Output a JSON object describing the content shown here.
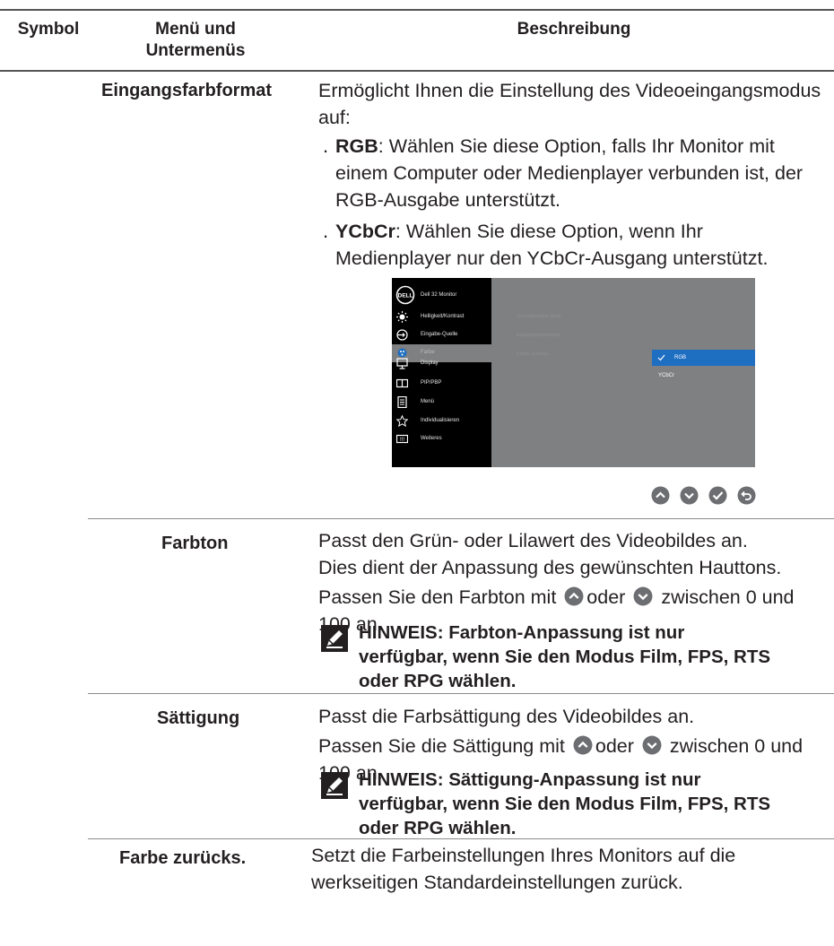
{
  "header": {
    "symbol": "Symbol",
    "menu_line1": "Menü und",
    "menu_line2": "Untermenüs",
    "description": "Beschreibung"
  },
  "rows": {
    "eingangsfarbformat": {
      "label": "Eingangsfarbformat",
      "desc_line1": "Ermöglicht Ihnen die Einstellung des Videoeingangsmodus",
      "desc_line2": "auf:",
      "rgb": {
        "term": "RGB",
        "line1": ": Wählen Sie diese Option, falls Ihr Monitor mit",
        "line2": "einem Computer oder Medienplayer verbunden ist, der",
        "line3": "RGB-Ausgabe unterstützt."
      },
      "ycbcr": {
        "term": "YCbCr",
        "line1": ": Wählen Sie diese Option, wenn Ihr",
        "line2": "Medienplayer nur den YCbCr-Ausgang unterstützt."
      }
    },
    "farbton": {
      "label": "Farbton",
      "line1": "Passt den Grün- oder Lilawert des Videobildes an.",
      "line2": "Dies dient der Anpassung des gewünschten Hauttons.",
      "line3a": "Passen Sie den Farbton mit",
      "line3b": "oder",
      "line3c": "zwischen 0 und",
      "line4": "100 an.",
      "note1": "HINWEIS: Farbton-Anpassung ist nur",
      "note2": "verfügbar, wenn Sie den Modus Film, FPS, RTS",
      "note3": "oder RPG wählen."
    },
    "saettigung": {
      "label": "Sättigung",
      "line1": "Passt die Farbsättigung des Videobildes an.",
      "line2a": "Passen Sie die Sättigung mit",
      "line2b": "oder",
      "line2c": "zwischen 0 und",
      "line3": "100 an.",
      "note1": "HINWEIS: Sättigung-Anpassung ist nur",
      "note2": "verfügbar, wenn Sie den Modus Film, FPS, RTS",
      "note3": "oder RPG wählen."
    },
    "farbe_zuruecks": {
      "label": "Farbe zurücks.",
      "line1": "Setzt die Farbeinstellungen Ihres Monitors auf die",
      "line2": "werkseitigen Standardeinstellungen zurück."
    }
  },
  "osd": {
    "logo": "DELL",
    "title": "Dell 32 Monitor",
    "menu": [
      {
        "label": "Helligkeit/Kontrast",
        "icon": "brightness-icon"
      },
      {
        "label": "Eingabe-Quelle",
        "icon": "input-source-icon"
      },
      {
        "label": "Farbe",
        "icon": "color-icon"
      },
      {
        "label": "Display",
        "icon": "display-icon"
      },
      {
        "label": "PIP/PBP",
        "icon": "pip-pbp-icon"
      },
      {
        "label": "Menü",
        "icon": "menu-icon"
      },
      {
        "label": "Individualisieren",
        "icon": "star-icon"
      },
      {
        "label": "Weiteres",
        "icon": "others-icon"
      }
    ],
    "submenu": [
      "Voreingestellte Modi",
      "Eingangsfarbformat",
      "Farbe zurücks."
    ],
    "options": [
      "RGB",
      "YCbCr"
    ],
    "nav_buttons": [
      "up-button-icon",
      "down-button-icon",
      "ok-button-icon",
      "back-button-icon"
    ]
  },
  "colors": {
    "text": "#231f20",
    "osd_panel": "#7e8082",
    "osd_highlight": "#1e6ec1",
    "button_grey": "#6d6e71"
  }
}
